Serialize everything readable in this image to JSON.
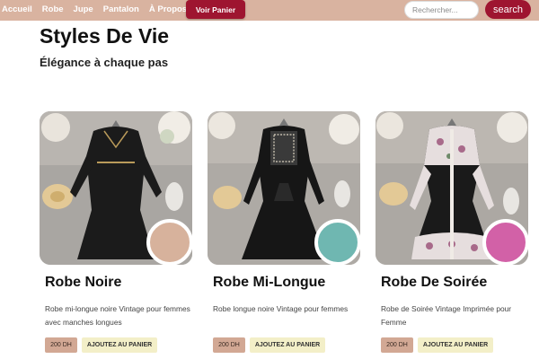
{
  "nav": {
    "links": [
      "Accueil",
      "Robe",
      "Jupe",
      "Pantalon",
      "À Propos"
    ],
    "cart_label": "Voir Panier",
    "search_placeholder": "Rechercher...",
    "search_button": "search",
    "bar_color": "#d9b3a0",
    "accent_color": "#9e1530"
  },
  "hero": {
    "title": "Styles De Vie",
    "subtitle": "Élégance à chaque pas"
  },
  "products": [
    {
      "title": "Robe Noire",
      "description": "Robe mi-longue noire Vintage pour femmes avec manches longues",
      "price": "200 DH",
      "add_label": "AJOUTEZ AU PANIER",
      "swatch_color": "#d7b29c",
      "image_icon": "black-dress-photo"
    },
    {
      "title": "Robe Mi-Longue",
      "description": "Robe longue noire Vintage pour femmes",
      "price": "200 DH",
      "add_label": "AJOUTEZ AU PANIER",
      "swatch_color": "#6fb7b1",
      "image_icon": "embroidered-dress-photo"
    },
    {
      "title": "Robe De Soirée",
      "description": "Robe de Soirée Vintage Imprimée pour Femme",
      "price": "200 DH",
      "add_label": "AJOUTEZ AU PANIER",
      "swatch_color": "#d261a7",
      "image_icon": "floral-dress-photo"
    }
  ]
}
